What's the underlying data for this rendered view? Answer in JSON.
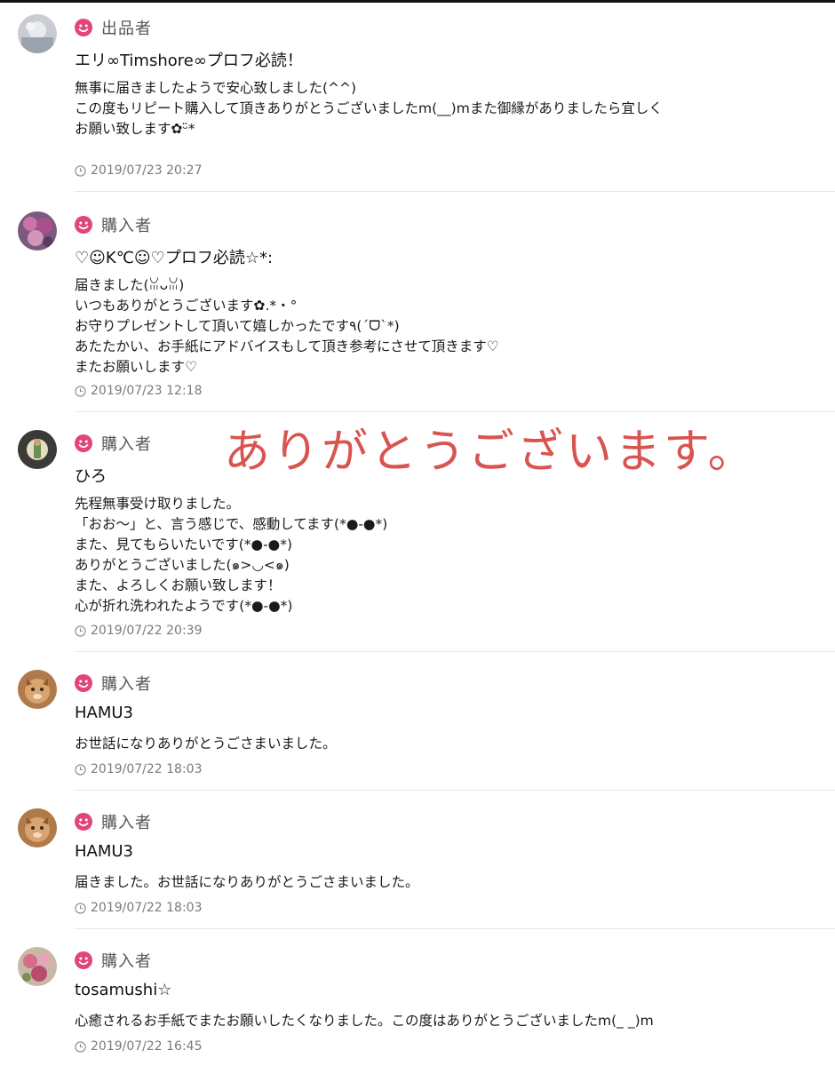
{
  "colors": {
    "role_icon": "#e0457b",
    "overlay_text": "#d9544f",
    "timestamp": "#7a7a7a"
  },
  "overlay": {
    "text": "ありがとうございます。"
  },
  "entries": [
    {
      "role": "出品者",
      "username": "エリ∞Timshore∞プロフ必読！",
      "message_lines": [
        "無事に届きましたようで安心致しました(^^)",
        "この度もリピート購入して頂きありがとうございましたm(__)mまた御縁がありましたら宜しく",
        "お願い致します✿ᵕ̈*"
      ],
      "timestamp": "2019/07/23 20:27"
    },
    {
      "role": "購入者",
      "username": "♡☺K℃☺♡プロフ必読☆*:",
      "message_lines": [
        "届きました(ꈍᴗꈍ)",
        "いつもありがとうございます✿.*・°",
        "お守りプレゼントして頂いて嬉しかったです٩(ˊᗜˋ*)",
        "あたたかい、お手紙にアドバイスもして頂き参考にさせて頂きます♡",
        "またお願いします♡"
      ],
      "timestamp": "2019/07/23 12:18"
    },
    {
      "role": "購入者",
      "username": "ひろ",
      "message_lines": [
        "先程無事受け取りました。",
        "「おお〜」と、言う感じで、感動してます(*●-●*)",
        "また、見てもらいたいです(*●-●*)",
        "ありがとうございました(๑>◡<๑)",
        "また、よろしくお願い致します！",
        "心が折れ洗われたようです(*●-●*)"
      ],
      "timestamp": "2019/07/22 20:39"
    },
    {
      "role": "購入者",
      "username": "HAMU3",
      "message_lines": [
        "お世話になりありがとうごさまいました。"
      ],
      "timestamp": "2019/07/22 18:03"
    },
    {
      "role": "購入者",
      "username": "HAMU3",
      "message_lines": [
        "届きました。お世話になりありがとうごさまいました。"
      ],
      "timestamp": "2019/07/22 18:03"
    },
    {
      "role": "購入者",
      "username": "tosamushi☆",
      "message_lines": [
        "心癒されるお手紙でまたお願いしたくなりました。この度はありがとうございましたm(_ _)m"
      ],
      "timestamp": "2019/07/22 16:45"
    }
  ]
}
